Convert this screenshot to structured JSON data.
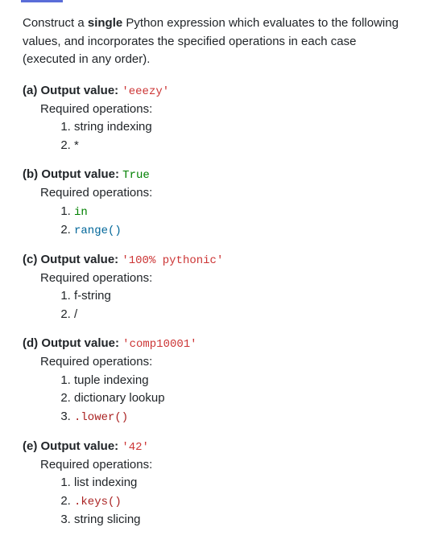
{
  "intro": {
    "pre": "Construct a ",
    "bold": "single",
    "post": " Python expression which evaluates to the following values, and incorporates the specified operations in each case (executed in any order)."
  },
  "required_ops_label": "Required operations:",
  "output_label": "Output value: ",
  "parts": {
    "a": {
      "letter": "(a) ",
      "value": "'eeezy'",
      "value_class": "c-red",
      "ops": [
        "string indexing",
        "*"
      ]
    },
    "b": {
      "letter": "(b) ",
      "value": "True",
      "value_class": "c-green",
      "ops_special": [
        {
          "text": "in",
          "cls": "c-green code"
        },
        {
          "text": "range()",
          "cls": "c-blue code"
        }
      ]
    },
    "c": {
      "letter": "(c) ",
      "value": "'100% pythonic'",
      "value_class": "c-red",
      "ops": [
        "f-string",
        "/"
      ]
    },
    "d": {
      "letter": "(d) ",
      "value": "'comp10001'",
      "value_class": "c-red",
      "ops": [
        "tuple indexing",
        "dictionary lookup"
      ],
      "ops_code": [
        ".lower()"
      ]
    },
    "e": {
      "letter": "(e) ",
      "value": "'42'",
      "value_class": "c-red",
      "ops_plain": [
        "list indexing"
      ],
      "ops_code": [
        ".keys()"
      ],
      "ops_plain_after": [
        "string slicing"
      ]
    }
  }
}
